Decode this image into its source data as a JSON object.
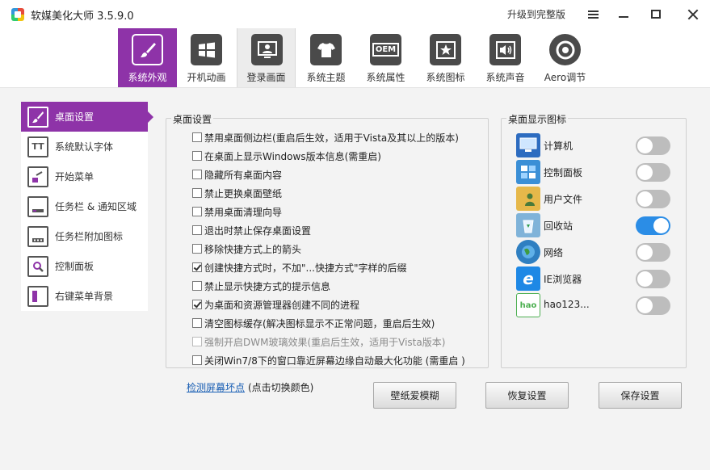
{
  "window": {
    "title": "软媒美化大师 3.5.9.0",
    "upgrade": "升级到完整版"
  },
  "tabs": [
    {
      "label": "系统外观",
      "icon": "brush-icon"
    },
    {
      "label": "开机动画",
      "icon": "windows-logo-icon"
    },
    {
      "label": "登录画面",
      "icon": "user-screen-icon"
    },
    {
      "label": "系统主题",
      "icon": "tshirt-icon"
    },
    {
      "label": "系统属性",
      "icon": "oem-icon",
      "glyph": "OEM"
    },
    {
      "label": "系统图标",
      "icon": "star-icon"
    },
    {
      "label": "系统声音",
      "icon": "speaker-icon"
    },
    {
      "label": "Aero调节",
      "icon": "aero-icon"
    }
  ],
  "sidebar": {
    "items": [
      {
        "label": "桌面设置",
        "icon": "brush-icon"
      },
      {
        "label": "系统默认字体",
        "icon": "font-icon",
        "glyph": "TT"
      },
      {
        "label": "开始菜单",
        "icon": "start-menu-icon"
      },
      {
        "label": "任务栏 & 通知区域",
        "icon": "taskbar-icon"
      },
      {
        "label": "任务栏附加图标",
        "icon": "taskbar-addon-icon"
      },
      {
        "label": "控制面板",
        "icon": "control-panel-icon"
      },
      {
        "label": "右键菜单背景",
        "icon": "context-menu-icon"
      }
    ]
  },
  "desktop_settings": {
    "title": "桌面设置",
    "options": [
      {
        "label": "禁用桌面侧边栏(重启后生效，适用于Vista及其以上的版本)",
        "checked": false
      },
      {
        "label": "在桌面上显示Windows版本信息(需重启)",
        "checked": false
      },
      {
        "label": "隐藏所有桌面内容",
        "checked": false
      },
      {
        "label": "禁止更换桌面壁纸",
        "checked": false
      },
      {
        "label": "禁用桌面清理向导",
        "checked": false
      },
      {
        "label": "退出时禁止保存桌面设置",
        "checked": false
      },
      {
        "label": "移除快捷方式上的箭头",
        "checked": false
      },
      {
        "label": "创建快捷方式时，不加\"...快捷方式\"字样的后缀",
        "checked": true
      },
      {
        "label": "禁止显示快捷方式的提示信息",
        "checked": false
      },
      {
        "label": "为桌面和资源管理器创建不同的进程",
        "checked": true
      },
      {
        "label": "清空图标缓存(解决图标显示不正常问题，重启后生效)",
        "checked": false
      },
      {
        "label": "强制开启DWM玻璃效果(重启后生效，适用于Vista版本)",
        "checked": false,
        "disabled": true
      },
      {
        "label": "关闭Win7/8下的窗口靠近屏幕边缘自动最大化功能 (需重启 )",
        "checked": false
      }
    ]
  },
  "desktop_icons": {
    "title": "桌面显示图标",
    "items": [
      {
        "label": "计算机",
        "on": false,
        "icon": "computer-icon",
        "color": "#2d6cc0"
      },
      {
        "label": "控制面板",
        "on": false,
        "icon": "control-panel-icon",
        "color": "#3b8fd6"
      },
      {
        "label": "用户文件",
        "on": false,
        "icon": "user-folder-icon",
        "color": "#e6b84a"
      },
      {
        "label": "回收站",
        "on": true,
        "icon": "recycle-bin-icon",
        "color": "#7fb3d9"
      },
      {
        "label": "网络",
        "on": false,
        "icon": "network-globe-icon",
        "color": "#2f7fc1"
      },
      {
        "label": "IE浏览器",
        "on": false,
        "icon": "ie-browser-icon",
        "color": "#1e88e5",
        "glyph": "e"
      },
      {
        "label": "hao123...",
        "on": false,
        "icon": "hao123-icon",
        "color": "#4caf50",
        "glyph": "hao"
      }
    ]
  },
  "footer": {
    "detect_link": "检测屏幕坏点",
    "detect_note": "(点击切换颜色)",
    "buttons": {
      "blur": "壁纸爱模糊",
      "restore": "恢复设置",
      "save": "保存设置"
    }
  },
  "colors": {
    "accent": "#8e33a8",
    "toggle_on": "#2b8de6",
    "toggle_off": "#bdbdbd",
    "link": "#1a5fb4"
  }
}
